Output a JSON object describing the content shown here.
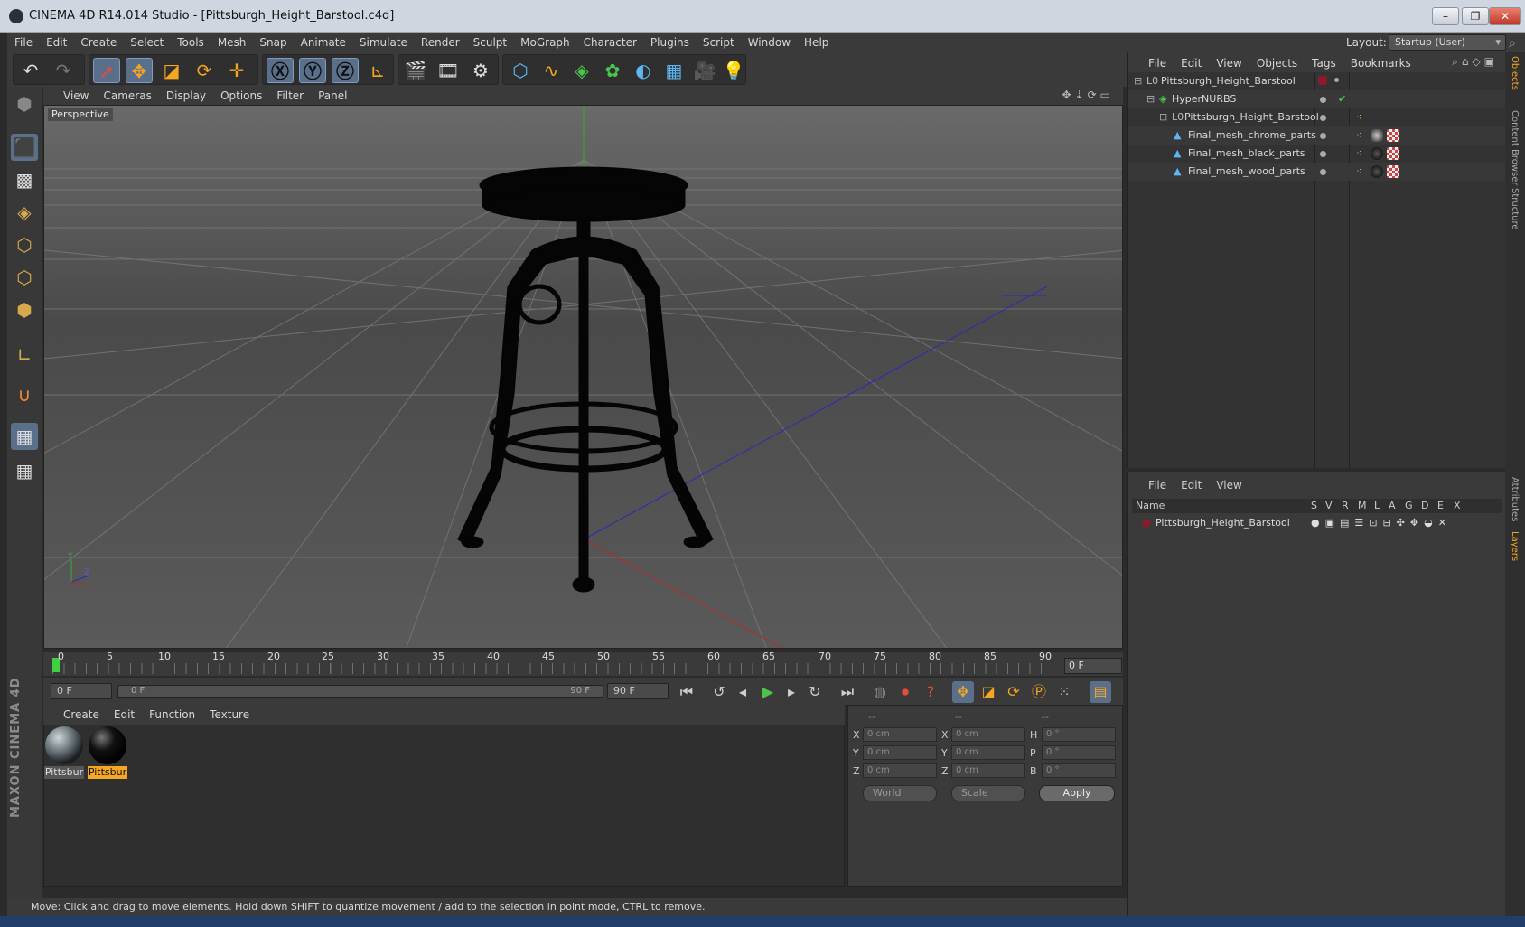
{
  "window": {
    "title": "CINEMA 4D R14.014 Studio - [Pittsburgh_Height_Barstool.c4d]",
    "controls": [
      "–",
      "❐",
      "✕"
    ]
  },
  "menu": [
    "File",
    "Edit",
    "Create",
    "Select",
    "Tools",
    "Mesh",
    "Snap",
    "Animate",
    "Simulate",
    "Render",
    "Sculpt",
    "MoGraph",
    "Character",
    "Plugins",
    "Script",
    "Window",
    "Help"
  ],
  "layout": {
    "label": "Layout:",
    "value": "Startup (User)"
  },
  "viewport": {
    "menu": [
      "View",
      "Cameras",
      "Display",
      "Options",
      "Filter",
      "Panel"
    ],
    "label": "Perspective",
    "axis_y": "Y",
    "axis_z": "Z"
  },
  "timeline": {
    "ticks": [
      "0",
      "5",
      "10",
      "15",
      "20",
      "25",
      "30",
      "35",
      "40",
      "45",
      "50",
      "55",
      "60",
      "65",
      "70",
      "75",
      "80",
      "85",
      "90"
    ],
    "current_frame": "0 F",
    "start_field": "0 F",
    "range_left": "0 F",
    "range_right": "90 F",
    "end_field": "90 F"
  },
  "materials": {
    "menu": [
      "Create",
      "Edit",
      "Function",
      "Texture"
    ],
    "items": [
      {
        "label": "Pittsbur",
        "selected": false
      },
      {
        "label": "Pittsbur",
        "selected": true
      }
    ]
  },
  "coordinates": {
    "headers": [
      "--",
      "--",
      "--"
    ],
    "rows": [
      {
        "pos_label": "X",
        "pos": "0 cm",
        "size_label": "X",
        "size": "0 cm",
        "rot_label": "H",
        "rot": "0 °"
      },
      {
        "pos_label": "Y",
        "pos": "0 cm",
        "size_label": "Y",
        "size": "0 cm",
        "rot_label": "P",
        "rot": "0 °"
      },
      {
        "pos_label": "Z",
        "pos": "0 cm",
        "size_label": "Z",
        "size": "0 cm",
        "rot_label": "B",
        "rot": "0 °"
      }
    ],
    "mode": "World",
    "size_mode": "Scale",
    "apply": "Apply"
  },
  "status": "Move: Click and drag to move elements. Hold down SHIFT to quantize movement / add to the selection in point mode, CTRL to remove.",
  "objects": {
    "menu": [
      "File",
      "Edit",
      "View",
      "Objects",
      "Tags",
      "Bookmarks"
    ],
    "tree": [
      {
        "name": "Pittsburgh_Height_Barstool",
        "level": 0,
        "icon": "null-icon",
        "tags": []
      },
      {
        "name": "HyperNURBS",
        "level": 1,
        "icon": "hypernurbs-icon",
        "tags": []
      },
      {
        "name": "Pittsburgh_Height_Barstool",
        "level": 2,
        "icon": "null-icon",
        "tags": [
          "phong"
        ]
      },
      {
        "name": "Final_mesh_chrome_parts",
        "level": 3,
        "icon": "polygon-icon",
        "tags": [
          "phong",
          "material-chrome",
          "uvw"
        ]
      },
      {
        "name": "Final_mesh_black_parts",
        "level": 3,
        "icon": "polygon-icon",
        "tags": [
          "phong",
          "material-black",
          "uvw"
        ]
      },
      {
        "name": "Final_mesh_wood_parts",
        "level": 3,
        "icon": "polygon-icon",
        "tags": [
          "phong",
          "material-black",
          "uvw"
        ]
      }
    ]
  },
  "layers": {
    "menu": [
      "File",
      "Edit",
      "View"
    ],
    "columns": [
      "Name",
      "S",
      "V",
      "R",
      "M",
      "L",
      "A",
      "G",
      "D",
      "E",
      "X"
    ],
    "rows": [
      {
        "name": "Pittsburgh_Height_Barstool",
        "color": "#8b1a2b"
      }
    ]
  },
  "side_tabs": [
    "Objects",
    "Content Browser",
    "Structure",
    "Attributes",
    "Layers"
  ],
  "brand": "MAXON CINEMA 4D",
  "colors": {
    "accent": "#f5a623",
    "selection": "#5a6f8a",
    "background": "#3a3a3a"
  }
}
